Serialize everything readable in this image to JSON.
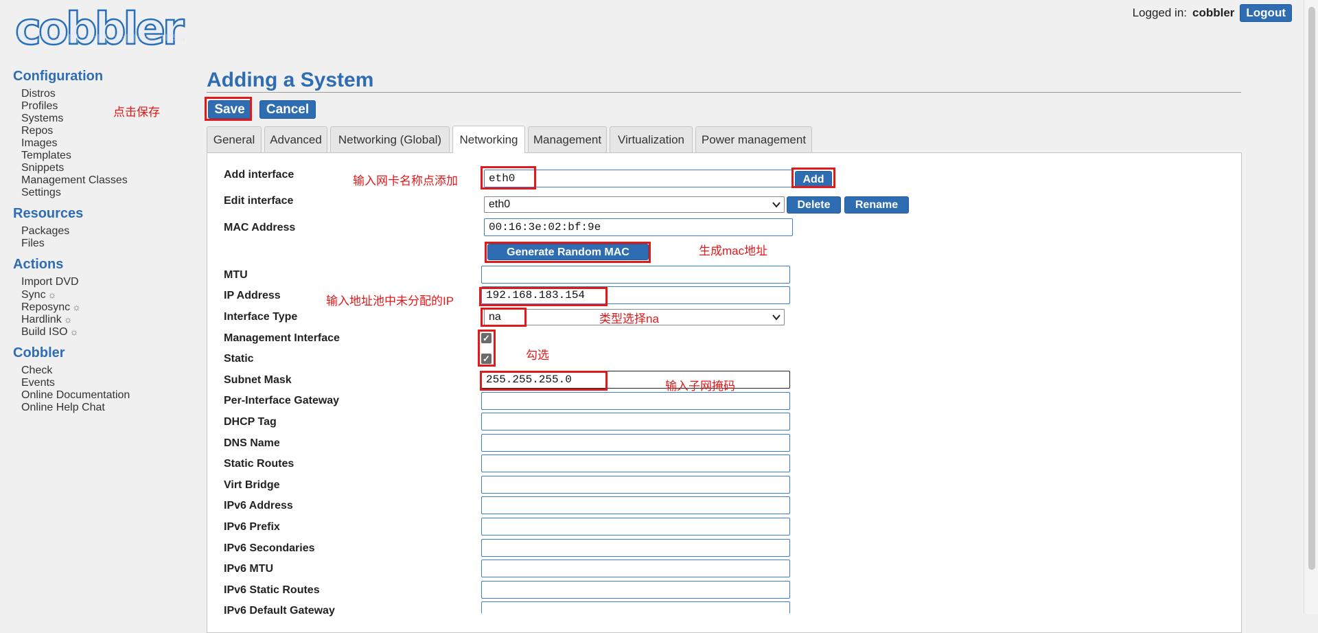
{
  "header": {
    "logo_text": "cobbler",
    "logged_in_label": "Logged in:",
    "username": "cobbler",
    "logout_label": "Logout"
  },
  "sidebar": {
    "sections": [
      {
        "title": "Configuration",
        "items": [
          "Distros",
          "Profiles",
          "Systems",
          "Repos",
          "Images",
          "Templates",
          "Snippets",
          "Management Classes",
          "Settings"
        ]
      },
      {
        "title": "Resources",
        "items": [
          "Packages",
          "Files"
        ]
      },
      {
        "title": "Actions",
        "items": [
          "Import DVD",
          "Sync",
          "Reposync",
          "Hardlink",
          "Build ISO"
        ]
      },
      {
        "title": "Cobbler",
        "items": [
          "Check",
          "Events",
          "Online Documentation",
          "Online Help Chat"
        ]
      }
    ],
    "gear_glyph": "☼"
  },
  "page": {
    "title": "Adding a System",
    "save_label": "Save",
    "cancel_label": "Cancel"
  },
  "tabs": [
    "General",
    "Advanced",
    "Networking (Global)",
    "Networking",
    "Management",
    "Virtualization",
    "Power management"
  ],
  "active_tab": "Networking",
  "form": {
    "add_interface": {
      "label": "Add interface",
      "value": "eth0",
      "button": "Add"
    },
    "edit_interface": {
      "label": "Edit interface",
      "selected": "eth0",
      "delete_label": "Delete",
      "rename_label": "Rename"
    },
    "mac": {
      "label": "MAC Address",
      "value": "00:16:3e:02:bf:9e",
      "generate_label": "Generate Random MAC"
    },
    "mtu": {
      "label": "MTU",
      "value": ""
    },
    "ip": {
      "label": "IP Address",
      "value": "192.168.183.154"
    },
    "interface_type": {
      "label": "Interface Type",
      "selected": "na"
    },
    "management_interface": {
      "label": "Management Interface",
      "checked": true
    },
    "static": {
      "label": "Static",
      "checked": true
    },
    "subnet": {
      "label": "Subnet Mask",
      "value": "255.255.255.0"
    },
    "gateway": {
      "label": "Per-Interface Gateway",
      "value": ""
    },
    "dhcp_tag": {
      "label": "DHCP Tag",
      "value": ""
    },
    "dns_name": {
      "label": "DNS Name",
      "value": ""
    },
    "static_routes": {
      "label": "Static Routes",
      "value": ""
    },
    "virt_bridge": {
      "label": "Virt Bridge",
      "value": ""
    },
    "ipv6_address": {
      "label": "IPv6 Address",
      "value": ""
    },
    "ipv6_prefix": {
      "label": "IPv6 Prefix",
      "value": ""
    },
    "ipv6_secondaries": {
      "label": "IPv6 Secondaries",
      "value": ""
    },
    "ipv6_mtu": {
      "label": "IPv6 MTU",
      "value": ""
    },
    "ipv6_static_routes": {
      "label": "IPv6 Static Routes",
      "value": ""
    },
    "ipv6_default_gateway": {
      "label": "IPv6 Default Gateway",
      "value": ""
    }
  },
  "annotations": {
    "save": "点击保存",
    "add": "输入网卡名称点添加",
    "mac": "生成mac地址",
    "ip": "输入地址池中未分配的IP",
    "type": "类型选择na",
    "check": "勾选",
    "subnet": "输入子网掩码"
  },
  "colors": {
    "accent": "#2f6db3",
    "annotation": "#e0191a"
  }
}
